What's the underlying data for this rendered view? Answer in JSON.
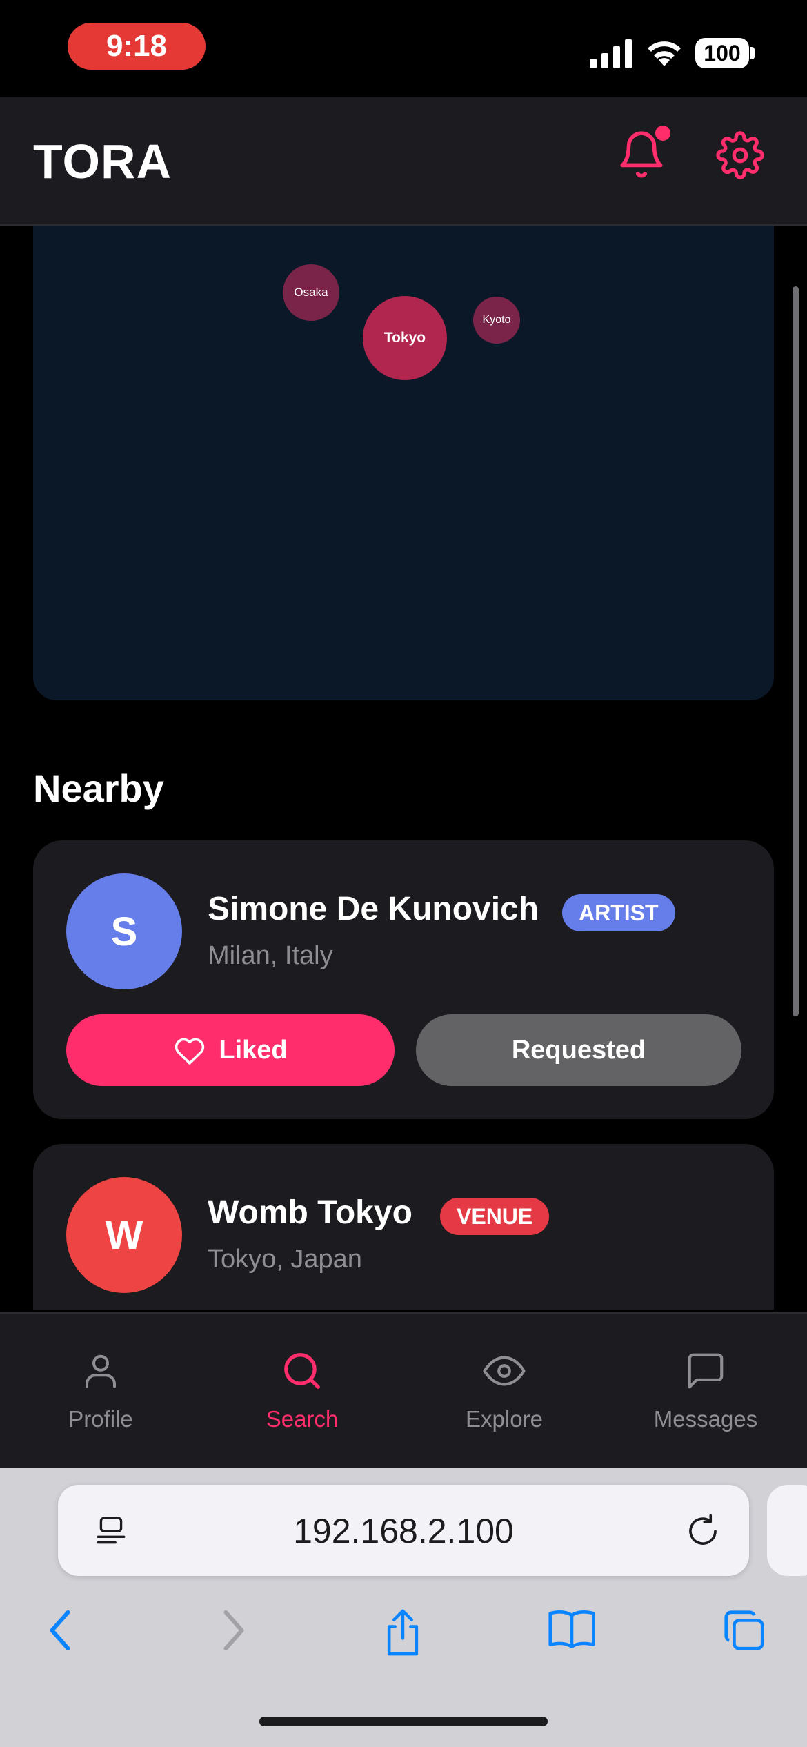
{
  "status_bar": {
    "time": "9:18",
    "battery": "100"
  },
  "header": {
    "brand": "TORA"
  },
  "map": {
    "cities": [
      {
        "name": "Osaka"
      },
      {
        "name": "Tokyo"
      },
      {
        "name": "Kyoto"
      }
    ]
  },
  "nearby": {
    "title": "Nearby",
    "cards": [
      {
        "initial": "S",
        "name": "Simone De Kunovich",
        "location": "Milan, Italy",
        "badge": "ARTIST",
        "avatar_color": "#667eea",
        "badge_color": "#667eea",
        "liked_label": "Liked",
        "requested_label": "Requested"
      },
      {
        "initial": "W",
        "name": "Womb Tokyo",
        "location": "Tokyo, Japan",
        "badge": "VENUE",
        "avatar_color": "#ef4444",
        "badge_color": "#e53945"
      }
    ]
  },
  "tabs": [
    {
      "label": "Profile",
      "icon": "person-icon",
      "active": false
    },
    {
      "label": "Search",
      "icon": "search-icon",
      "active": true
    },
    {
      "label": "Explore",
      "icon": "eye-icon",
      "active": false
    },
    {
      "label": "Messages",
      "icon": "message-icon",
      "active": false
    }
  ],
  "browser": {
    "url": "192.168.2.100"
  },
  "colors": {
    "accent": "#ff2d6b",
    "background": "#000000",
    "card": "#1c1b1f",
    "map": "#0b1828"
  }
}
